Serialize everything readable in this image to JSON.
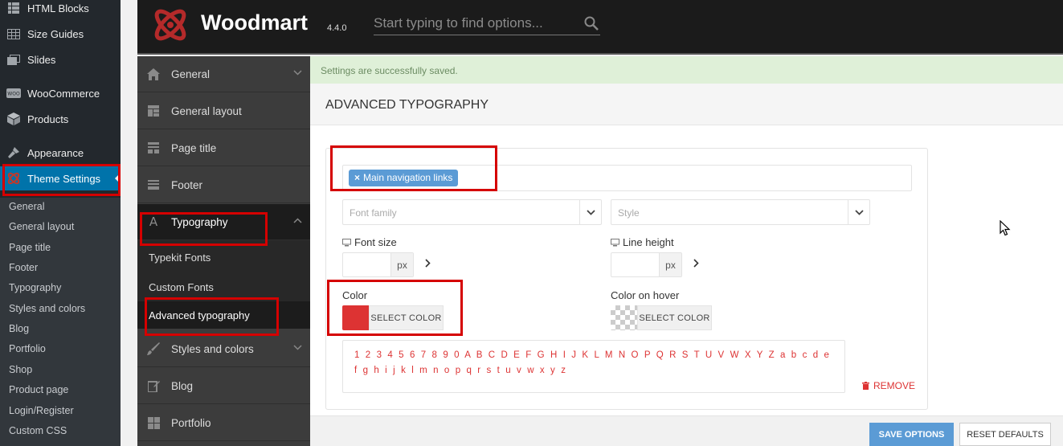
{
  "wp_sidebar": {
    "items": [
      {
        "label": "HTML Blocks",
        "icon": "grid-icon"
      },
      {
        "label": "Size Guides",
        "icon": "table-icon"
      },
      {
        "label": "Slides",
        "icon": "slides-icon"
      },
      {
        "label": "WooCommerce",
        "icon": "woo-icon"
      },
      {
        "label": "Products",
        "icon": "box-icon"
      },
      {
        "label": "Appearance",
        "icon": "brush-icon"
      },
      {
        "label": "Theme Settings",
        "icon": "woodmart-icon"
      }
    ],
    "submenu": [
      "General",
      "General layout",
      "Page title",
      "Footer",
      "Typography",
      "Styles and colors",
      "Blog",
      "Portfolio",
      "Shop",
      "Product page",
      "Login/Register",
      "Custom CSS"
    ]
  },
  "header": {
    "brand": "Woodmart",
    "version": "4.4.0",
    "search_placeholder": "Start typing to find options..."
  },
  "menu": {
    "items": [
      {
        "label": "General",
        "icon": "home-icon"
      },
      {
        "label": "General layout",
        "icon": "layout-icon"
      },
      {
        "label": "Page title",
        "icon": "page-title-icon"
      },
      {
        "label": "Footer",
        "icon": "footer-icon"
      },
      {
        "label": "Typography",
        "icon": "font-icon"
      },
      {
        "label": "Styles and colors",
        "icon": "brush-icon"
      },
      {
        "label": "Blog",
        "icon": "edit-icon"
      },
      {
        "label": "Portfolio",
        "icon": "grid-icon"
      }
    ],
    "typography_sub": [
      "Typekit Fonts",
      "Custom Fonts",
      "Advanced typography"
    ]
  },
  "main": {
    "notice": "Settings are successfully saved.",
    "section_title": "ADVANCED TYPOGRAPHY",
    "selector_tag": "Main navigation links",
    "tag_remove": "×",
    "font_family_placeholder": "Font family",
    "style_placeholder": "Style",
    "font_size_label": "Font size",
    "line_height_label": "Line height",
    "unit": "px",
    "color_label": "Color",
    "color_hover_label": "Color on hover",
    "select_color": "SELECT COLOR",
    "color_value": "#dd3333",
    "preview_text": "1 2 3 4 5 6 7 8 9 0 A B C D E F G H I J K L M N O P Q R S T U V W X Y Z a b c d e f g h i j k l m n o p q r s t u v w x y z",
    "remove_label": "REMOVE",
    "save_button": "SAVE OPTIONS",
    "reset_button": "RESET DEFAULTS"
  },
  "colors": {
    "wp_sidebar": "#23282d",
    "wp_active": "#0073aa",
    "accent_blue": "#5b9bd5",
    "highlight_red": "#d50000",
    "preview_red": "#dd3333"
  }
}
